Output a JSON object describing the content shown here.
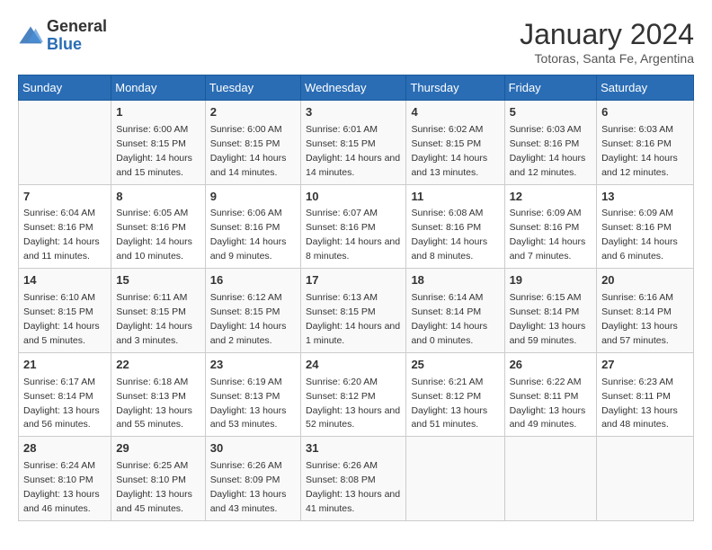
{
  "header": {
    "logo_general": "General",
    "logo_blue": "Blue",
    "month_title": "January 2024",
    "location": "Totoras, Santa Fe, Argentina"
  },
  "days_of_week": [
    "Sunday",
    "Monday",
    "Tuesday",
    "Wednesday",
    "Thursday",
    "Friday",
    "Saturday"
  ],
  "weeks": [
    [
      {
        "day": "",
        "sunrise": "",
        "sunset": "",
        "daylight": ""
      },
      {
        "day": "1",
        "sunrise": "Sunrise: 6:00 AM",
        "sunset": "Sunset: 8:15 PM",
        "daylight": "Daylight: 14 hours and 15 minutes."
      },
      {
        "day": "2",
        "sunrise": "Sunrise: 6:00 AM",
        "sunset": "Sunset: 8:15 PM",
        "daylight": "Daylight: 14 hours and 14 minutes."
      },
      {
        "day": "3",
        "sunrise": "Sunrise: 6:01 AM",
        "sunset": "Sunset: 8:15 PM",
        "daylight": "Daylight: 14 hours and 14 minutes."
      },
      {
        "day": "4",
        "sunrise": "Sunrise: 6:02 AM",
        "sunset": "Sunset: 8:15 PM",
        "daylight": "Daylight: 14 hours and 13 minutes."
      },
      {
        "day": "5",
        "sunrise": "Sunrise: 6:03 AM",
        "sunset": "Sunset: 8:16 PM",
        "daylight": "Daylight: 14 hours and 12 minutes."
      },
      {
        "day": "6",
        "sunrise": "Sunrise: 6:03 AM",
        "sunset": "Sunset: 8:16 PM",
        "daylight": "Daylight: 14 hours and 12 minutes."
      }
    ],
    [
      {
        "day": "7",
        "sunrise": "Sunrise: 6:04 AM",
        "sunset": "Sunset: 8:16 PM",
        "daylight": "Daylight: 14 hours and 11 minutes."
      },
      {
        "day": "8",
        "sunrise": "Sunrise: 6:05 AM",
        "sunset": "Sunset: 8:16 PM",
        "daylight": "Daylight: 14 hours and 10 minutes."
      },
      {
        "day": "9",
        "sunrise": "Sunrise: 6:06 AM",
        "sunset": "Sunset: 8:16 PM",
        "daylight": "Daylight: 14 hours and 9 minutes."
      },
      {
        "day": "10",
        "sunrise": "Sunrise: 6:07 AM",
        "sunset": "Sunset: 8:16 PM",
        "daylight": "Daylight: 14 hours and 8 minutes."
      },
      {
        "day": "11",
        "sunrise": "Sunrise: 6:08 AM",
        "sunset": "Sunset: 8:16 PM",
        "daylight": "Daylight: 14 hours and 8 minutes."
      },
      {
        "day": "12",
        "sunrise": "Sunrise: 6:09 AM",
        "sunset": "Sunset: 8:16 PM",
        "daylight": "Daylight: 14 hours and 7 minutes."
      },
      {
        "day": "13",
        "sunrise": "Sunrise: 6:09 AM",
        "sunset": "Sunset: 8:16 PM",
        "daylight": "Daylight: 14 hours and 6 minutes."
      }
    ],
    [
      {
        "day": "14",
        "sunrise": "Sunrise: 6:10 AM",
        "sunset": "Sunset: 8:15 PM",
        "daylight": "Daylight: 14 hours and 5 minutes."
      },
      {
        "day": "15",
        "sunrise": "Sunrise: 6:11 AM",
        "sunset": "Sunset: 8:15 PM",
        "daylight": "Daylight: 14 hours and 3 minutes."
      },
      {
        "day": "16",
        "sunrise": "Sunrise: 6:12 AM",
        "sunset": "Sunset: 8:15 PM",
        "daylight": "Daylight: 14 hours and 2 minutes."
      },
      {
        "day": "17",
        "sunrise": "Sunrise: 6:13 AM",
        "sunset": "Sunset: 8:15 PM",
        "daylight": "Daylight: 14 hours and 1 minute."
      },
      {
        "day": "18",
        "sunrise": "Sunrise: 6:14 AM",
        "sunset": "Sunset: 8:14 PM",
        "daylight": "Daylight: 14 hours and 0 minutes."
      },
      {
        "day": "19",
        "sunrise": "Sunrise: 6:15 AM",
        "sunset": "Sunset: 8:14 PM",
        "daylight": "Daylight: 13 hours and 59 minutes."
      },
      {
        "day": "20",
        "sunrise": "Sunrise: 6:16 AM",
        "sunset": "Sunset: 8:14 PM",
        "daylight": "Daylight: 13 hours and 57 minutes."
      }
    ],
    [
      {
        "day": "21",
        "sunrise": "Sunrise: 6:17 AM",
        "sunset": "Sunset: 8:14 PM",
        "daylight": "Daylight: 13 hours and 56 minutes."
      },
      {
        "day": "22",
        "sunrise": "Sunrise: 6:18 AM",
        "sunset": "Sunset: 8:13 PM",
        "daylight": "Daylight: 13 hours and 55 minutes."
      },
      {
        "day": "23",
        "sunrise": "Sunrise: 6:19 AM",
        "sunset": "Sunset: 8:13 PM",
        "daylight": "Daylight: 13 hours and 53 minutes."
      },
      {
        "day": "24",
        "sunrise": "Sunrise: 6:20 AM",
        "sunset": "Sunset: 8:12 PM",
        "daylight": "Daylight: 13 hours and 52 minutes."
      },
      {
        "day": "25",
        "sunrise": "Sunrise: 6:21 AM",
        "sunset": "Sunset: 8:12 PM",
        "daylight": "Daylight: 13 hours and 51 minutes."
      },
      {
        "day": "26",
        "sunrise": "Sunrise: 6:22 AM",
        "sunset": "Sunset: 8:11 PM",
        "daylight": "Daylight: 13 hours and 49 minutes."
      },
      {
        "day": "27",
        "sunrise": "Sunrise: 6:23 AM",
        "sunset": "Sunset: 8:11 PM",
        "daylight": "Daylight: 13 hours and 48 minutes."
      }
    ],
    [
      {
        "day": "28",
        "sunrise": "Sunrise: 6:24 AM",
        "sunset": "Sunset: 8:10 PM",
        "daylight": "Daylight: 13 hours and 46 minutes."
      },
      {
        "day": "29",
        "sunrise": "Sunrise: 6:25 AM",
        "sunset": "Sunset: 8:10 PM",
        "daylight": "Daylight: 13 hours and 45 minutes."
      },
      {
        "day": "30",
        "sunrise": "Sunrise: 6:26 AM",
        "sunset": "Sunset: 8:09 PM",
        "daylight": "Daylight: 13 hours and 43 minutes."
      },
      {
        "day": "31",
        "sunrise": "Sunrise: 6:26 AM",
        "sunset": "Sunset: 8:08 PM",
        "daylight": "Daylight: 13 hours and 41 minutes."
      },
      {
        "day": "",
        "sunrise": "",
        "sunset": "",
        "daylight": ""
      },
      {
        "day": "",
        "sunrise": "",
        "sunset": "",
        "daylight": ""
      },
      {
        "day": "",
        "sunrise": "",
        "sunset": "",
        "daylight": ""
      }
    ]
  ]
}
